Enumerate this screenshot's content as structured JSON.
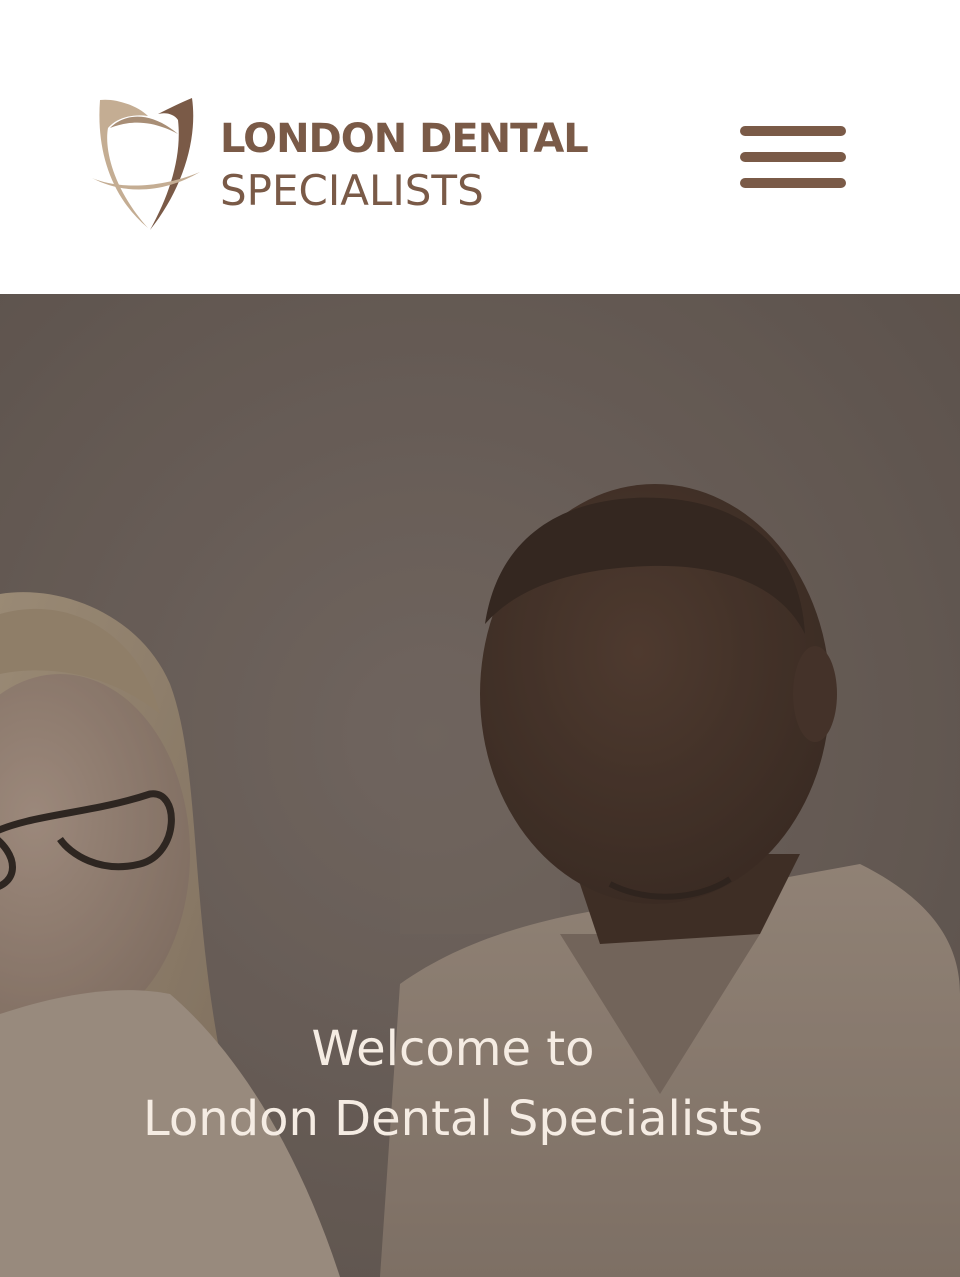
{
  "header": {
    "logo": {
      "line1": "LONDON DENTAL",
      "line2": "SPECIALISTS",
      "icon": "tooth-logo-icon"
    },
    "menu_icon": "hamburger-menu-icon"
  },
  "hero": {
    "heading_line1": "Welcome to",
    "heading_line2": "London Dental Specialists"
  },
  "colors": {
    "brand_brown": "#7a5a47",
    "brand_beige": "#c4ad93",
    "hero_text": "#f5ece3"
  }
}
